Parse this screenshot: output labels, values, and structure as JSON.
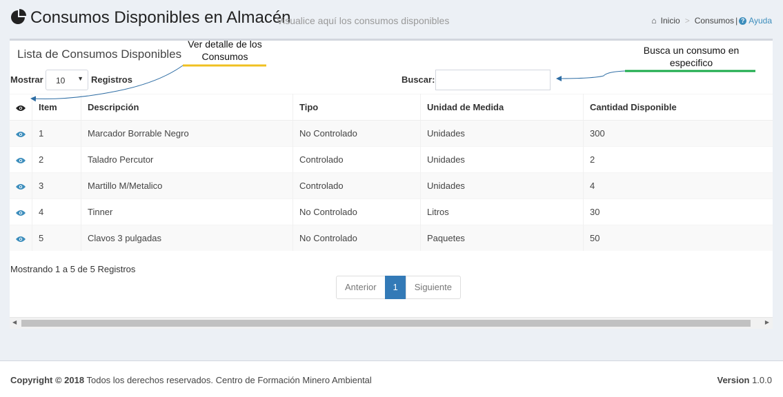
{
  "header": {
    "title": "Consumos Disponibles en Almacén",
    "subtitle": "Visualice aquí los consumos disponibles",
    "breadcrumb": {
      "home": "Inicio",
      "current": "Consumos",
      "help": "Ayuda"
    }
  },
  "box": {
    "title": "Lista de Consumos Disponibles",
    "length_label": "Mostrar",
    "length_value": "10",
    "length_suffix": "Registros",
    "search_label": "Buscar:",
    "search_value": ""
  },
  "table": {
    "columns": [
      "Item",
      "Descripción",
      "Tipo",
      "Unidad de Medida",
      "Cantidad Disponible"
    ],
    "rows": [
      {
        "item": "1",
        "descripcion": "Marcador Borrable Negro",
        "tipo": "No Controlado",
        "unidad": "Unidades",
        "cantidad": "300"
      },
      {
        "item": "2",
        "descripcion": "Taladro Percutor",
        "tipo": "Controlado",
        "unidad": "Unidades",
        "cantidad": "2"
      },
      {
        "item": "3",
        "descripcion": "Martillo M/Metalico",
        "tipo": "Controlado",
        "unidad": "Unidades",
        "cantidad": "4"
      },
      {
        "item": "4",
        "descripcion": "Tinner",
        "tipo": "No Controlado",
        "unidad": "Litros",
        "cantidad": "30"
      },
      {
        "item": "5",
        "descripcion": "Clavos 3 pulgadas",
        "tipo": "No Controlado",
        "unidad": "Paquetes",
        "cantidad": "50"
      }
    ]
  },
  "info": "Mostrando 1 a 5 de 5 Registros",
  "pagination": {
    "prev": "Anterior",
    "current": "1",
    "next": "Siguiente"
  },
  "footer": {
    "copyright_bold": "Copyright © 2018",
    "copyright_text": " Todos los derechos reservados. Centro de Formación Minero Ambiental",
    "version_label": "Version",
    "version_value": " 1.0.0"
  },
  "annotations": {
    "detail_line1": "Ver detalle de los",
    "detail_line2": "Consumos",
    "search_line1": "Busca un consumo en",
    "search_line2": "especifico"
  },
  "colors": {
    "accent": "#3c8dbc",
    "primary": "#337ab7",
    "annotation_yellow": "#f0c020",
    "annotation_green": "#1aaa4a",
    "arrow": "#2e6da4"
  },
  "icons": {
    "title": "pie-chart-icon",
    "home": "home-icon",
    "help": "help-icon",
    "view": "eye-icon"
  }
}
